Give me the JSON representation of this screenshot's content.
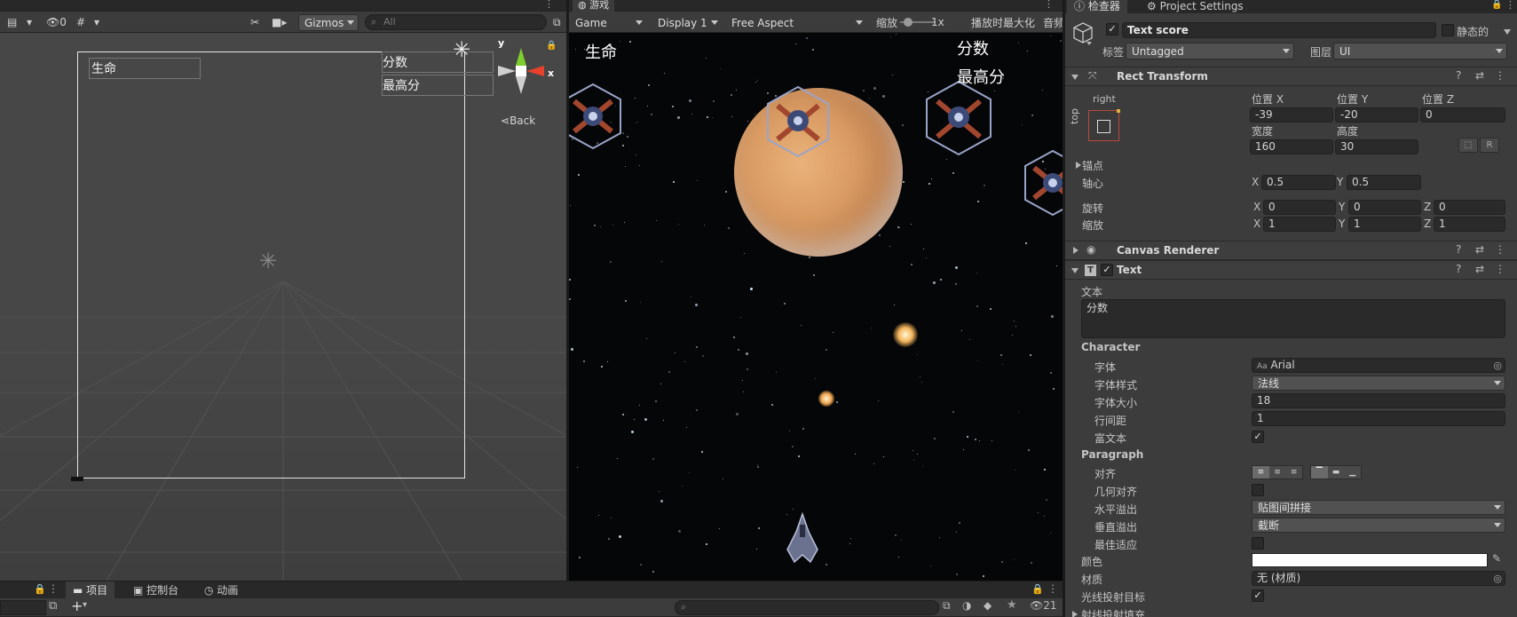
{
  "scene_toolbar": {
    "hidden_count": "0",
    "gizmos_label": "Gizmos",
    "search_placeholder": "All"
  },
  "scene_view": {
    "label_life": "生命",
    "label_score": "分数",
    "label_highscore": "最高分",
    "gizmo_y": "y",
    "gizmo_x": "x",
    "back_label": "Back"
  },
  "game_tab": {
    "tab_label": "游戏",
    "display_mode": "Game",
    "display": "Display 1",
    "aspect": "Free Aspect",
    "zoom_label": "缩放",
    "zoom_value": "1x",
    "maximize_label": "播放时最大化",
    "audio_label": "音频"
  },
  "game_view": {
    "life_text": "生命",
    "score_text": "分数",
    "highscore_text": "最高分"
  },
  "bottom_bar": {
    "tab_project": "项目",
    "tab_console": "控制台",
    "tab_animation": "动画",
    "hidden_count": "21"
  },
  "inspector": {
    "tab_inspector": "检查器",
    "tab_project_settings": "Project Settings",
    "object_name": "Text score",
    "static_label": "静态的",
    "tag_label": "标签",
    "tag_value": "Untagged",
    "layer_label": "图层",
    "layer_value": "UI",
    "rect_transform": {
      "title": "Rect Transform",
      "anchor_h": "right",
      "anchor_v": "top",
      "pos_x_label": "位置 X",
      "pos_y_label": "位置 Y",
      "pos_z_label": "位置 Z",
      "pos_x": "-39",
      "pos_y": "-20",
      "pos_z": "0",
      "width_label": "宽度",
      "height_label": "高度",
      "width": "160",
      "height": "30",
      "btn_r": "R",
      "anchors_label": "锚点",
      "pivot_label": "轴心",
      "pivot_x": "0.5",
      "pivot_y": "0.5",
      "rotation_label": "旋转",
      "rot_x": "0",
      "rot_y": "0",
      "rot_z": "0",
      "scale_label": "缩放",
      "scale_x": "1",
      "scale_y": "1",
      "scale_z": "1",
      "axis_x": "X",
      "axis_y": "Y",
      "axis_z": "Z"
    },
    "canvas_renderer": {
      "title": "Canvas Renderer"
    },
    "text_component": {
      "title": "Text",
      "text_label": "文本",
      "text_value": "分数",
      "character_header": "Character",
      "font_label": "字体",
      "font_value": "Arial",
      "font_style_label": "字体样式",
      "font_style_value": "法线",
      "font_size_label": "字体大小",
      "font_size_value": "18",
      "line_spacing_label": "行间距",
      "line_spacing_value": "1",
      "rich_text_label": "富文本",
      "paragraph_header": "Paragraph",
      "alignment_label": "对齐",
      "align_geometry_label": "几何对齐",
      "h_overflow_label": "水平溢出",
      "h_overflow_value": "贴图间拼接",
      "v_overflow_label": "垂直溢出",
      "v_overflow_value": "截断",
      "best_fit_label": "最佳适应",
      "color_label": "颜色",
      "color_value": "#ffffff",
      "material_label": "材质",
      "material_value": "无 (材质)",
      "raycast_label": "光线投射目标",
      "raycast_padding_label": "射线投射填充"
    }
  },
  "colors": {
    "accent_x": "#e8412c",
    "accent_y": "#7ecf2e",
    "panel": "#3c3c3c",
    "field": "#2a2a2a"
  }
}
